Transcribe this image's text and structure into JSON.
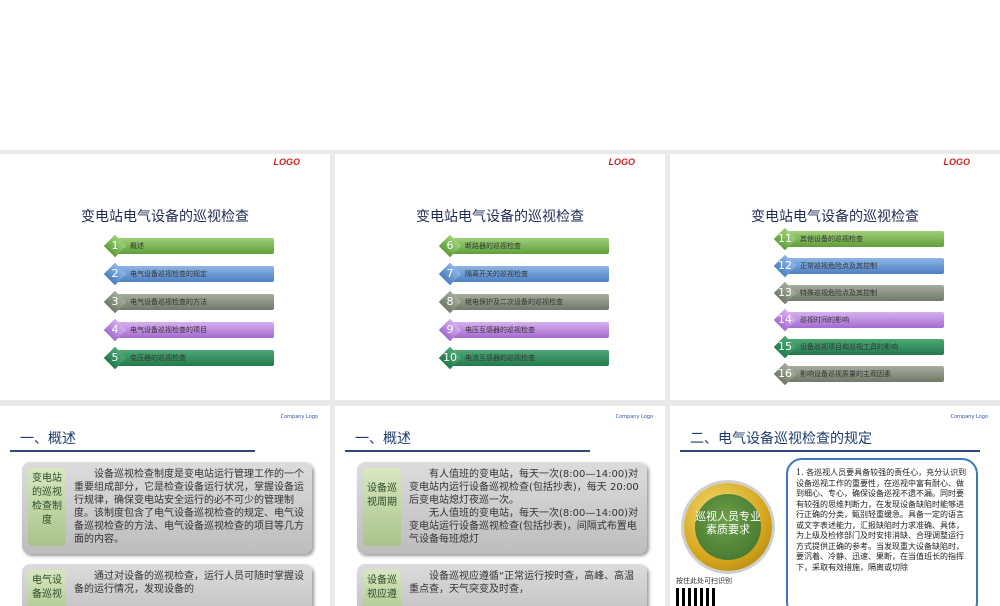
{
  "logo": "LOGO",
  "company_logo": "Company Logo",
  "toc_title": "变电站电气设备的巡视检查",
  "toc1": [
    {
      "n": "1",
      "label": "概述",
      "color": "g"
    },
    {
      "n": "2",
      "label": "电气设备巡视检查的规定",
      "color": "b"
    },
    {
      "n": "3",
      "label": "电气设备巡视检查的方法",
      "color": "gr"
    },
    {
      "n": "4",
      "label": "电气设备巡视检查的项目",
      "color": "p"
    },
    {
      "n": "5",
      "label": "变压器的巡视检查",
      "color": "dg"
    }
  ],
  "toc2": [
    {
      "n": "6",
      "label": "断路器的巡视检查",
      "color": "g"
    },
    {
      "n": "7",
      "label": "隔离开关的巡视检查",
      "color": "b"
    },
    {
      "n": "8",
      "label": "继电保护及二次设备的巡视检查",
      "color": "gr"
    },
    {
      "n": "9",
      "label": "电压互感器的巡视检查",
      "color": "p"
    },
    {
      "n": "10",
      "label": "电流互感器的巡视检查",
      "color": "dg"
    }
  ],
  "toc3": [
    {
      "n": "11",
      "label": "其他设备的巡视检查",
      "color": "g"
    },
    {
      "n": "12",
      "label": "正常巡视危险点及其控制",
      "color": "b"
    },
    {
      "n": "13",
      "label": "特殊巡视危险点及其控制",
      "color": "gr"
    },
    {
      "n": "14",
      "label": "巡视时间的影响",
      "color": "p"
    },
    {
      "n": "15",
      "label": "设备巡视项目和巡视工具的影响",
      "color": "dg"
    },
    {
      "n": "16",
      "label": "影响设备巡视质量的主观因素",
      "color": "gr"
    }
  ],
  "s4": {
    "heading": "一、概述",
    "tag1": "变电站的巡视检查制度",
    "text1": "设备巡视检查制度是变电站运行管理工作的一个重要组成部分，它是检查设备运行状况，掌握设备运行规律，确保变电站安全运行的必不可少的管理制度。该制度包含了电气设备巡视检查的规定、电气设备巡视检查的方法、电气设备巡视检查的项目等几方面的内容。",
    "tag2": "电气设备巡视",
    "text2": "通过对设备的巡视检查，运行人员可随时掌握设备的运行情况，发现设备的"
  },
  "s5": {
    "heading": "一、概述",
    "tag1": "设备巡视周期",
    "text1a": "有人值班的变电站，每天一次(8:00—14:00)对变电站内运行设备巡视检查(包括抄表)，每天 20:00 后变电站熄灯夜巡一次。",
    "text1b": "无人值班的变电站，每天一次(8:00—14:00)对变电站运行设备巡视检查(包括抄表)，间隔式布置电气设备每班熄灯",
    "tag2": "设备巡视应遵",
    "text2": "设备巡视应遵循“正常运行按时查，高峰、高温重点查，天气突变及时查，"
  },
  "s6": {
    "heading": "二、电气设备巡视检查的规定",
    "circle": "巡视人员专业素质要求",
    "body": "1. 各巡视人员要具备较强的责任心，充分认识到设备巡视工作的重要性，在巡视中富有耐心、做到细心、专心，确保设备巡视不遗不漏。同时要有较强的思维判断力，在发现设备缺陷时能够进行正确的分类，甄别轻重缓急。具备一定的语言或文字表述能力，汇报缺陷时力求准确、具体，为上级及检修部门及时安排消缺、合理调整运行方式提供正确的参考。当发现重大设备缺陷时，要沉着、冷静、迅速、果断，在当值班长的指挥下，采取有效措施，隔离或切除",
    "qr_caption": "按住此处可扫识别"
  }
}
